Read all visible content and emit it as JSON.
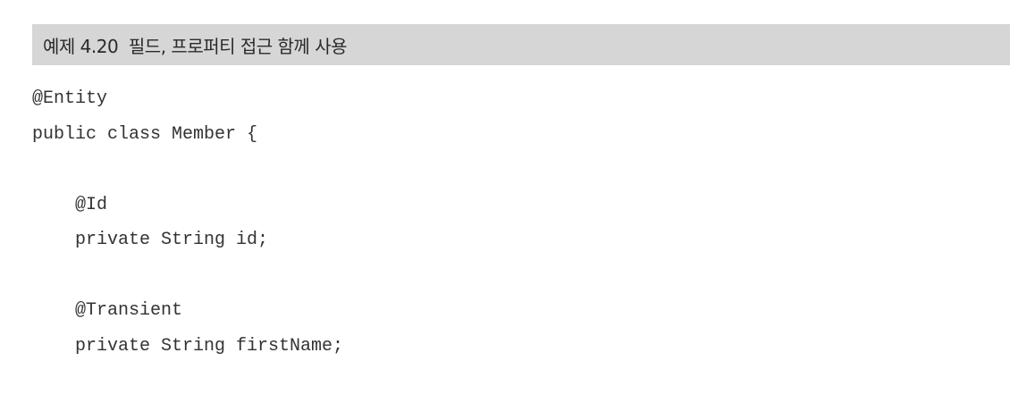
{
  "caption": {
    "title": "예제 4.20  필드, 프로퍼티 접근 함께 사용"
  },
  "code": {
    "lines": [
      "@Entity",
      "public class Member {",
      "",
      "    @Id",
      "    private String id;",
      "",
      "    @Transient",
      "    private String firstName;",
      "",
      ""
    ]
  }
}
